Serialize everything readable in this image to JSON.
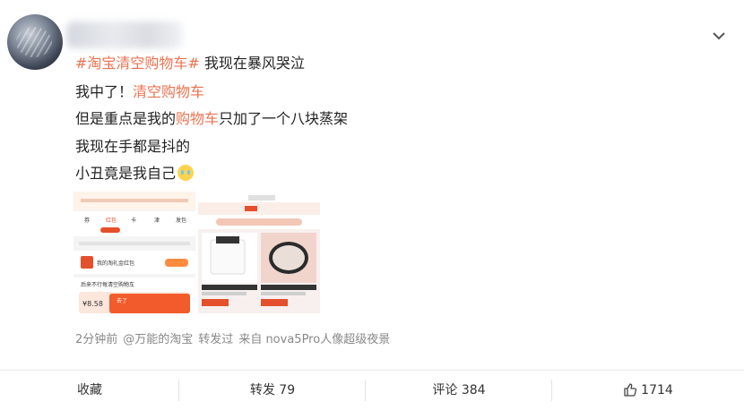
{
  "post": {
    "hashtag": "#淘宝清空购物车#",
    "line1_rest": " 我现在暴风哭泣",
    "line2_a": "我中了！",
    "line2_b": "清空购物车",
    "line3_a": "但是重点是我的",
    "line3_b": "购物车",
    "line3_c": "只加了一个八块蒸架",
    "line4": "我现在手都是抖的",
    "line5": "小丑竟是我自己"
  },
  "images": [
    {
      "name": "taobao-cart-screenshot",
      "tabs": [
        "券",
        "红包",
        "卡",
        "津",
        "发包"
      ],
      "section_label": "我的淘礼金红包",
      "banner": "后来不行每清空购物车",
      "button": "去了",
      "price": "¥8.58"
    },
    {
      "name": "taobao-store-screenshot"
    }
  ],
  "meta": {
    "time": "2分钟前",
    "source_user": "@万能的淘宝",
    "repost_label": "转发过",
    "device": "来自 nova5Pro人像超级夜景"
  },
  "actions": {
    "favorite": "收藏",
    "repost": "转发 79",
    "comment": "评论 384",
    "like": "1714"
  },
  "colors": {
    "accent": "#eb7350",
    "hashtag": "#eb7350",
    "meta": "#888888"
  },
  "icons": [
    "chevron-down-icon",
    "thumb-up-icon",
    "crying-emoji-icon"
  ]
}
